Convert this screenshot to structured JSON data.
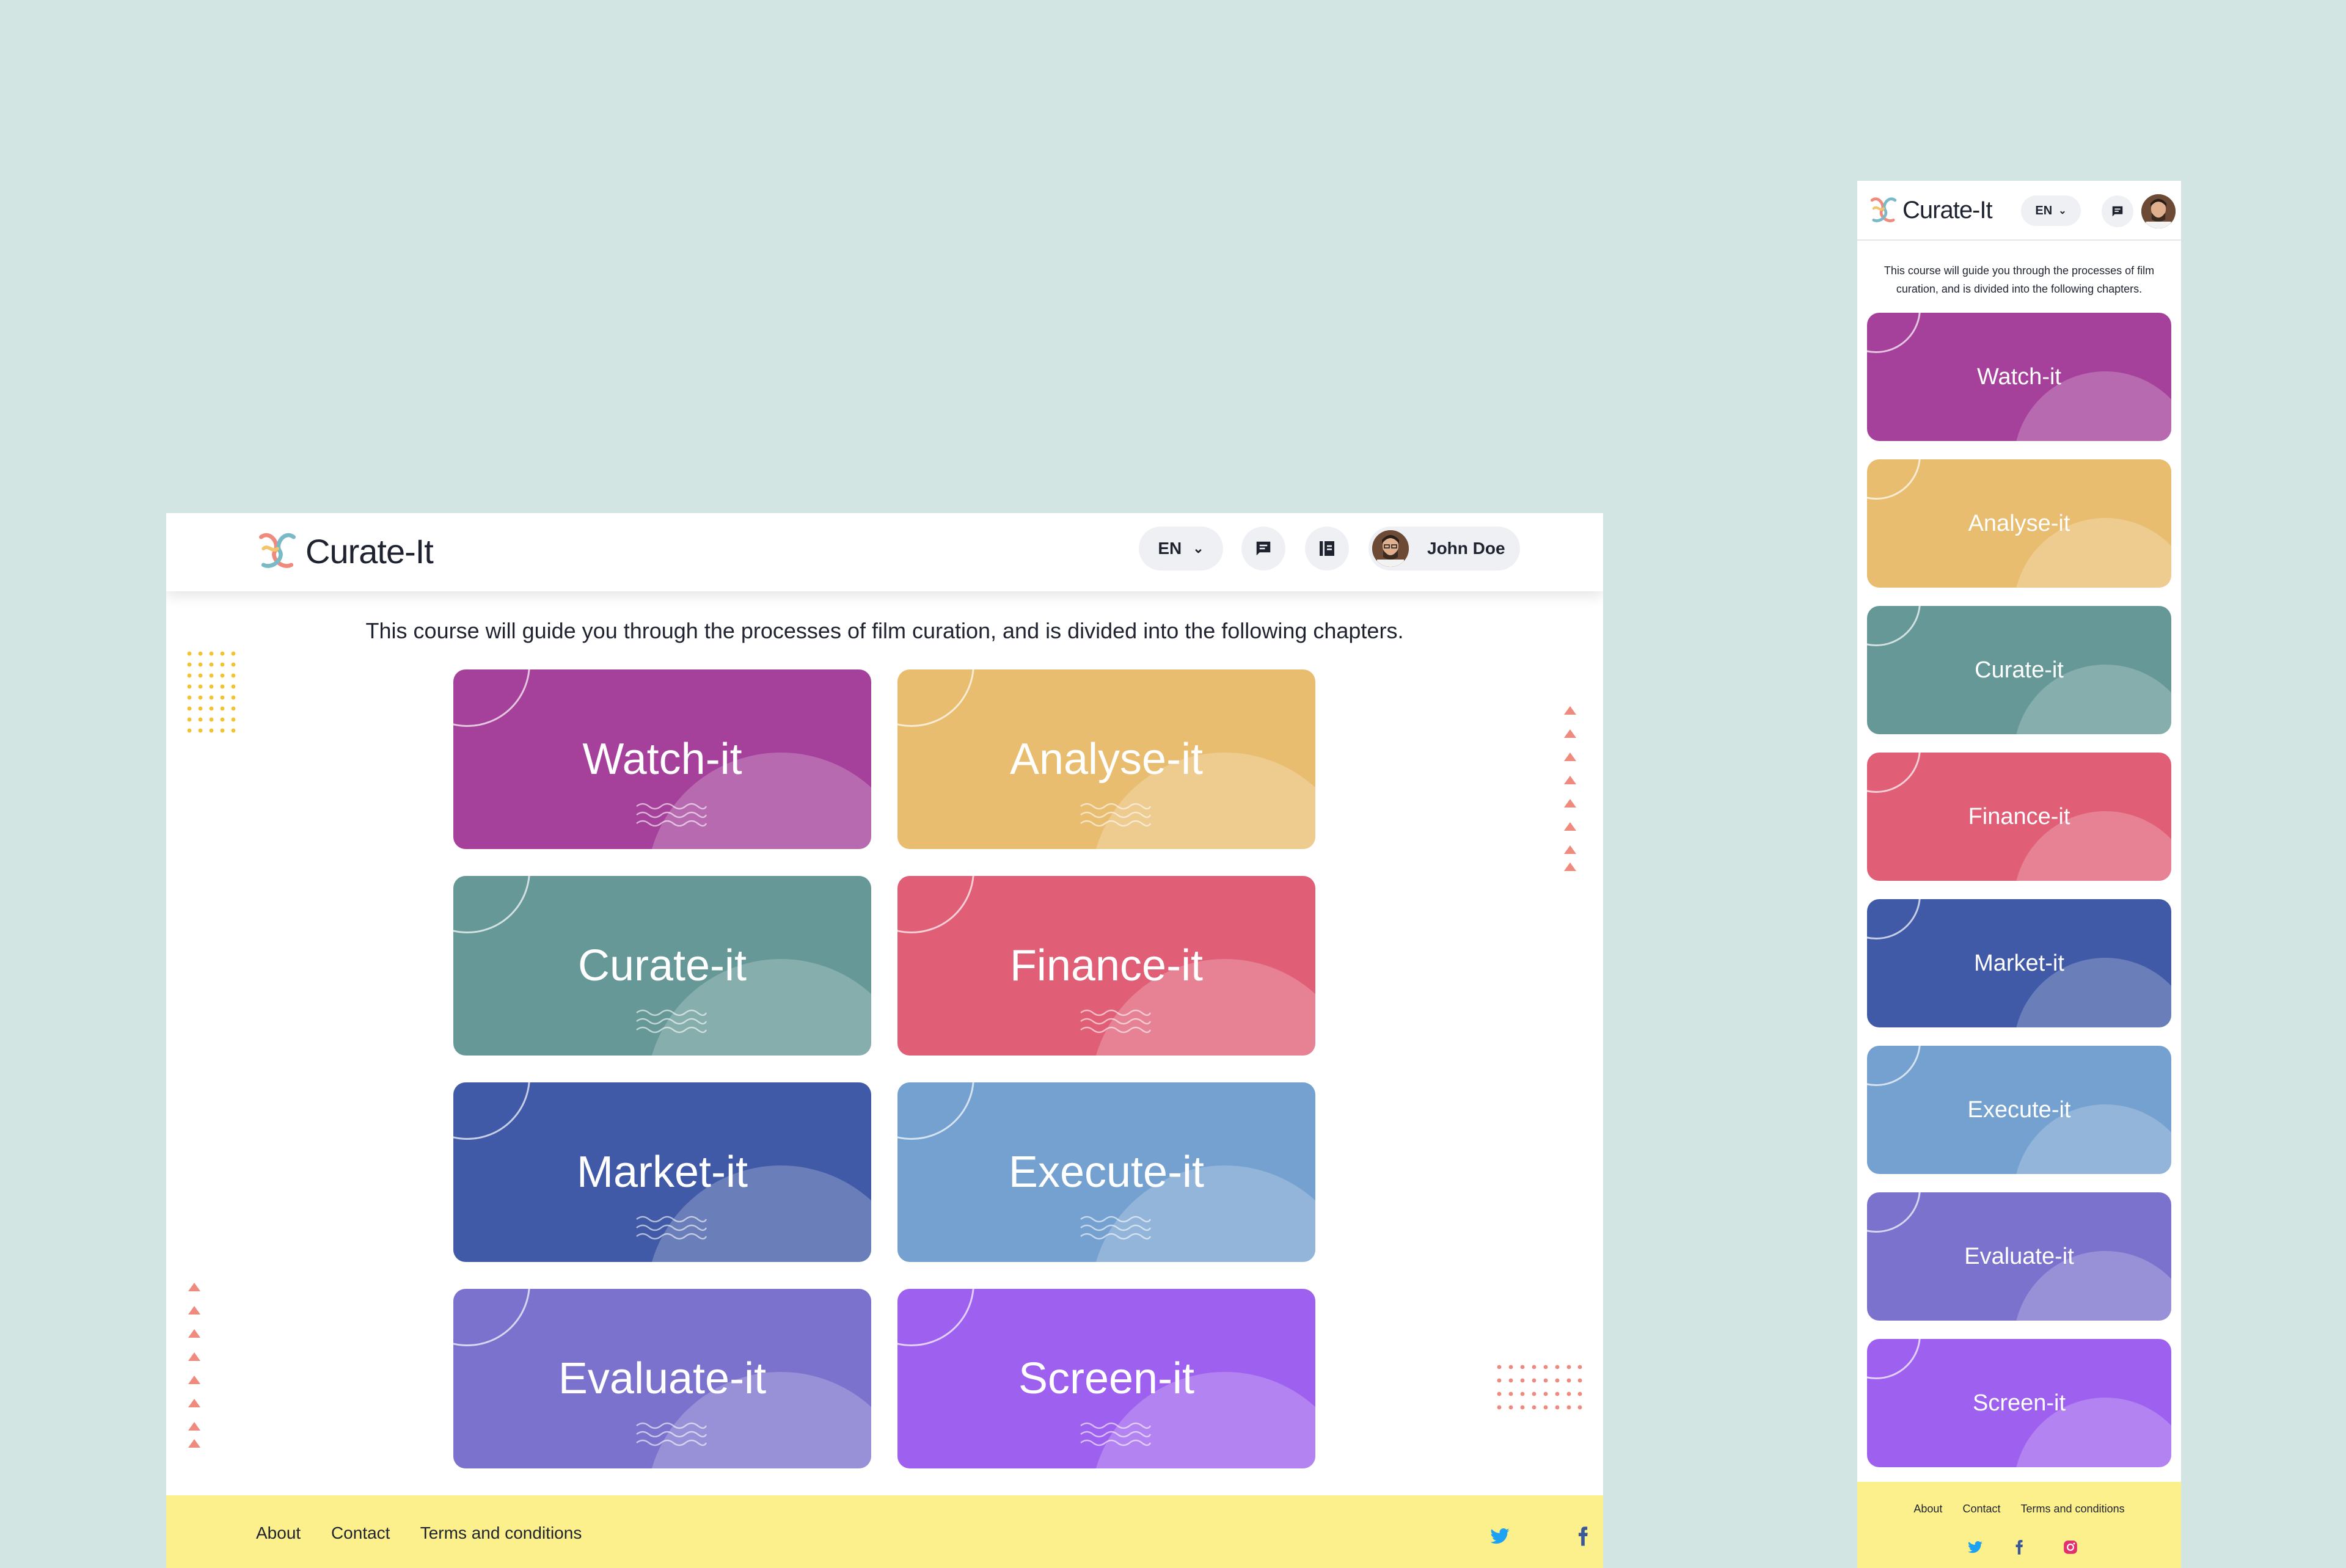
{
  "app": {
    "name": "Curate-It"
  },
  "header": {
    "language": "EN",
    "user_name": "John Doe"
  },
  "intro": "This course will guide you through the processes of film curation, and is divided into the following chapters.",
  "chapters": [
    {
      "label": "Watch-it",
      "color": "#a5409b"
    },
    {
      "label": "Analyse-it",
      "color": "#e9bd6f"
    },
    {
      "label": "Curate-it",
      "color": "#659896"
    },
    {
      "label": "Finance-it",
      "color": "#e05e76"
    },
    {
      "label": "Market-it",
      "color": "#405aa7"
    },
    {
      "label": "Execute-it",
      "color": "#74a1cf"
    },
    {
      "label": "Evaluate-it",
      "color": "#7b72cd"
    },
    {
      "label": "Screen-it",
      "color": "#9e60ef"
    }
  ],
  "footer": {
    "links": [
      "About",
      "Contact",
      "Terms and conditions"
    ],
    "social": [
      "twitter-icon",
      "facebook-icon",
      "instagram-icon"
    ]
  },
  "colors": {
    "background": "#d2e5e3",
    "footer": "#fbf08c",
    "twitter": "#1da1f2",
    "facebook": "#3b5998",
    "instagram": "#e1306c",
    "accent_dots": "#f2c230",
    "accent_triangles": "#ee8a7e"
  }
}
